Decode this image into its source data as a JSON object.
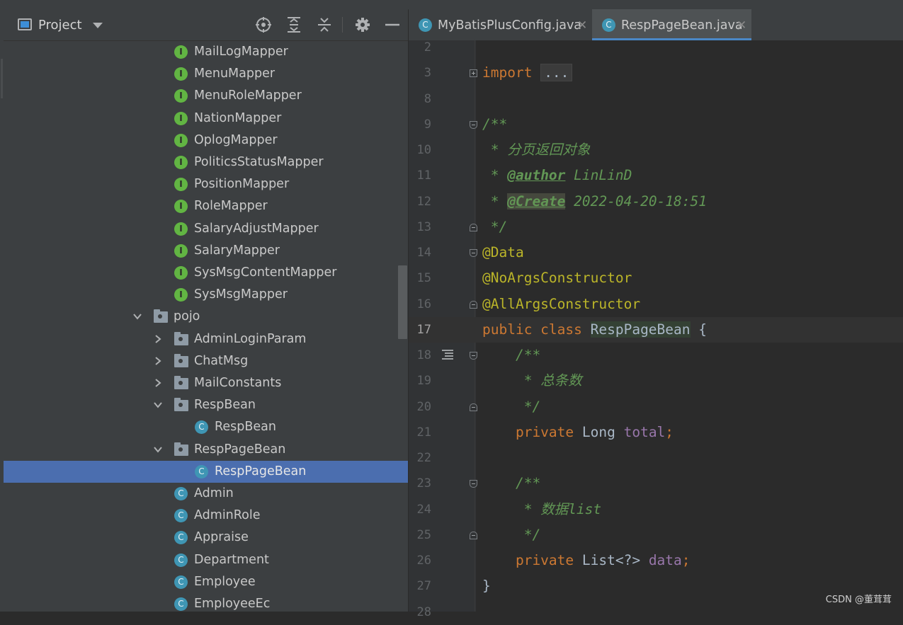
{
  "project_panel": {
    "title": "Project",
    "toolbar_icons": [
      "locate-icon",
      "expand-all-icon",
      "collapse-all-icon",
      "gear-icon",
      "hide-icon"
    ],
    "tree": [
      {
        "label": "MailLogMapper",
        "kind": "interface",
        "icon_letter": "I",
        "depth": 2
      },
      {
        "label": "MenuMapper",
        "kind": "interface",
        "icon_letter": "I",
        "depth": 2
      },
      {
        "label": "MenuRoleMapper",
        "kind": "interface",
        "icon_letter": "I",
        "depth": 2
      },
      {
        "label": "NationMapper",
        "kind": "interface",
        "icon_letter": "I",
        "depth": 2
      },
      {
        "label": "OplogMapper",
        "kind": "interface",
        "icon_letter": "I",
        "depth": 2
      },
      {
        "label": "PoliticsStatusMapper",
        "kind": "interface",
        "icon_letter": "I",
        "depth": 2
      },
      {
        "label": "PositionMapper",
        "kind": "interface",
        "icon_letter": "I",
        "depth": 2
      },
      {
        "label": "RoleMapper",
        "kind": "interface",
        "icon_letter": "I",
        "depth": 2
      },
      {
        "label": "SalaryAdjustMapper",
        "kind": "interface",
        "icon_letter": "I",
        "depth": 2
      },
      {
        "label": "SalaryMapper",
        "kind": "interface",
        "icon_letter": "I",
        "depth": 2
      },
      {
        "label": "SysMsgContentMapper",
        "kind": "interface",
        "icon_letter": "I",
        "depth": 2
      },
      {
        "label": "SysMsgMapper",
        "kind": "interface",
        "icon_letter": "I",
        "depth": 2
      },
      {
        "label": "pojo",
        "kind": "folder",
        "depth": 1,
        "expanded": true
      },
      {
        "label": "AdminLoginParam",
        "kind": "folder",
        "depth": 2,
        "expanded": false
      },
      {
        "label": "ChatMsg",
        "kind": "folder",
        "depth": 2,
        "expanded": false
      },
      {
        "label": "MailConstants",
        "kind": "folder",
        "depth": 2,
        "expanded": false
      },
      {
        "label": "RespBean",
        "kind": "folder",
        "depth": 2,
        "expanded": true
      },
      {
        "label": "RespBean",
        "kind": "class",
        "icon_letter": "C",
        "depth": 3
      },
      {
        "label": "RespPageBean",
        "kind": "folder",
        "depth": 2,
        "expanded": true
      },
      {
        "label": "RespPageBean",
        "kind": "class",
        "icon_letter": "C",
        "depth": 3,
        "selected": true
      },
      {
        "label": "Admin",
        "kind": "class",
        "icon_letter": "C",
        "depth": 2
      },
      {
        "label": "AdminRole",
        "kind": "class",
        "icon_letter": "C",
        "depth": 2
      },
      {
        "label": "Appraise",
        "kind": "class",
        "icon_letter": "C",
        "depth": 2
      },
      {
        "label": "Department",
        "kind": "class",
        "icon_letter": "C",
        "depth": 2
      },
      {
        "label": "Employee",
        "kind": "class",
        "icon_letter": "C",
        "depth": 2
      },
      {
        "label": "EmployeeEc",
        "kind": "class",
        "icon_letter": "C",
        "depth": 2
      }
    ]
  },
  "editor": {
    "tabs": [
      {
        "name": "MyBatisPlusConfig.java",
        "icon_letter": "C",
        "active": false
      },
      {
        "name": "RespPageBean.java",
        "icon_letter": "C",
        "active": true
      }
    ],
    "current_line": "17",
    "lines": [
      {
        "num": "2",
        "parts": []
      },
      {
        "num": "3",
        "parts": [
          {
            "t": "import ",
            "c": "kw"
          },
          {
            "t": "...",
            "c": "fold-box"
          }
        ]
      },
      {
        "num": "8",
        "parts": []
      },
      {
        "num": "9",
        "parts": [
          {
            "t": "/**",
            "c": "cm"
          }
        ]
      },
      {
        "num": "10",
        "parts": [
          {
            "t": " * 分页返回对象",
            "c": "cm"
          }
        ]
      },
      {
        "num": "11",
        "parts": [
          {
            "t": " * ",
            "c": "cm"
          },
          {
            "t": "@author",
            "c": "tag"
          },
          {
            "t": " LinLinD",
            "c": "cm"
          }
        ]
      },
      {
        "num": "12",
        "parts": [
          {
            "t": " * ",
            "c": "cm"
          },
          {
            "t": "@Create",
            "c": "tag tagbg"
          },
          {
            "t": " 2022-04-20-18:51",
            "c": "cm"
          }
        ]
      },
      {
        "num": "13",
        "parts": [
          {
            "t": " */",
            "c": "cm"
          }
        ]
      },
      {
        "num": "14",
        "parts": [
          {
            "t": "@Data",
            "c": "ann"
          }
        ]
      },
      {
        "num": "15",
        "parts": [
          {
            "t": "@NoArgsConstructor",
            "c": "ann"
          }
        ]
      },
      {
        "num": "16",
        "parts": [
          {
            "t": "@AllArgsConstructor",
            "c": "ann"
          }
        ]
      },
      {
        "num": "17",
        "parts": [
          {
            "t": "public class ",
            "c": "kw"
          },
          {
            "t": "RespPageBean",
            "c": "clsname"
          },
          {
            "t": " {",
            "c": ""
          }
        ]
      },
      {
        "num": "18",
        "parts": [
          {
            "t": "    /**",
            "c": "cm"
          }
        ]
      },
      {
        "num": "19",
        "parts": [
          {
            "t": "     * 总条数",
            "c": "cm"
          }
        ]
      },
      {
        "num": "20",
        "parts": [
          {
            "t": "     */",
            "c": "cm"
          }
        ]
      },
      {
        "num": "21",
        "parts": [
          {
            "t": "    private ",
            "c": "kw"
          },
          {
            "t": "Long ",
            "c": ""
          },
          {
            "t": "total",
            "c": "fld"
          },
          {
            "t": ";",
            "c": "kw"
          }
        ]
      },
      {
        "num": "22",
        "parts": []
      },
      {
        "num": "23",
        "parts": [
          {
            "t": "    /**",
            "c": "cm"
          }
        ]
      },
      {
        "num": "24",
        "parts": [
          {
            "t": "     * 数据list",
            "c": "cm"
          }
        ]
      },
      {
        "num": "25",
        "parts": [
          {
            "t": "     */",
            "c": "cm"
          }
        ]
      },
      {
        "num": "26",
        "parts": [
          {
            "t": "    private ",
            "c": "kw"
          },
          {
            "t": "List<?> ",
            "c": ""
          },
          {
            "t": "data",
            "c": "fld"
          },
          {
            "t": ";",
            "c": "kw"
          }
        ]
      },
      {
        "num": "27",
        "parts": [
          {
            "t": "}",
            "c": ""
          }
        ]
      },
      {
        "num": "28",
        "parts": []
      }
    ]
  },
  "watermark": "CSDN @董茸茸"
}
